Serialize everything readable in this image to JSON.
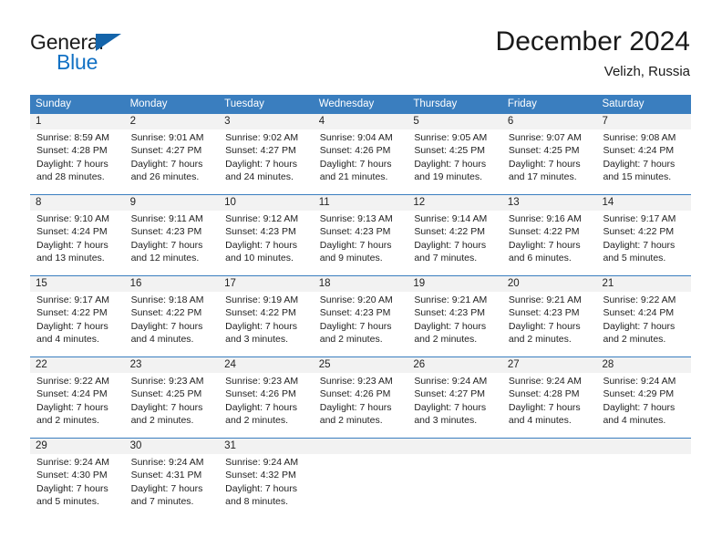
{
  "brand": {
    "name_part1": "General",
    "name_part2": "Blue",
    "logo_icon": "blue-triangle-logo"
  },
  "header": {
    "title": "December 2024",
    "subtitle": "Velizh, Russia"
  },
  "calendar": {
    "day_headers": [
      "Sunday",
      "Monday",
      "Tuesday",
      "Wednesday",
      "Thursday",
      "Friday",
      "Saturday"
    ],
    "colors": {
      "header_blue": "#3a7ebf",
      "daynum_band": "#f2f2f2",
      "brand_blue": "#1271c4",
      "text": "#222222"
    },
    "weeks": [
      {
        "days": [
          {
            "num": "1",
            "lines": [
              "Sunrise: 8:59 AM",
              "Sunset: 4:28 PM",
              "Daylight: 7 hours",
              "and 28 minutes."
            ]
          },
          {
            "num": "2",
            "lines": [
              "Sunrise: 9:01 AM",
              "Sunset: 4:27 PM",
              "Daylight: 7 hours",
              "and 26 minutes."
            ]
          },
          {
            "num": "3",
            "lines": [
              "Sunrise: 9:02 AM",
              "Sunset: 4:27 PM",
              "Daylight: 7 hours",
              "and 24 minutes."
            ]
          },
          {
            "num": "4",
            "lines": [
              "Sunrise: 9:04 AM",
              "Sunset: 4:26 PM",
              "Daylight: 7 hours",
              "and 21 minutes."
            ]
          },
          {
            "num": "5",
            "lines": [
              "Sunrise: 9:05 AM",
              "Sunset: 4:25 PM",
              "Daylight: 7 hours",
              "and 19 minutes."
            ]
          },
          {
            "num": "6",
            "lines": [
              "Sunrise: 9:07 AM",
              "Sunset: 4:25 PM",
              "Daylight: 7 hours",
              "and 17 minutes."
            ]
          },
          {
            "num": "7",
            "lines": [
              "Sunrise: 9:08 AM",
              "Sunset: 4:24 PM",
              "Daylight: 7 hours",
              "and 15 minutes."
            ]
          }
        ]
      },
      {
        "days": [
          {
            "num": "8",
            "lines": [
              "Sunrise: 9:10 AM",
              "Sunset: 4:24 PM",
              "Daylight: 7 hours",
              "and 13 minutes."
            ]
          },
          {
            "num": "9",
            "lines": [
              "Sunrise: 9:11 AM",
              "Sunset: 4:23 PM",
              "Daylight: 7 hours",
              "and 12 minutes."
            ]
          },
          {
            "num": "10",
            "lines": [
              "Sunrise: 9:12 AM",
              "Sunset: 4:23 PM",
              "Daylight: 7 hours",
              "and 10 minutes."
            ]
          },
          {
            "num": "11",
            "lines": [
              "Sunrise: 9:13 AM",
              "Sunset: 4:23 PM",
              "Daylight: 7 hours",
              "and 9 minutes."
            ]
          },
          {
            "num": "12",
            "lines": [
              "Sunrise: 9:14 AM",
              "Sunset: 4:22 PM",
              "Daylight: 7 hours",
              "and 7 minutes."
            ]
          },
          {
            "num": "13",
            "lines": [
              "Sunrise: 9:16 AM",
              "Sunset: 4:22 PM",
              "Daylight: 7 hours",
              "and 6 minutes."
            ]
          },
          {
            "num": "14",
            "lines": [
              "Sunrise: 9:17 AM",
              "Sunset: 4:22 PM",
              "Daylight: 7 hours",
              "and 5 minutes."
            ]
          }
        ]
      },
      {
        "days": [
          {
            "num": "15",
            "lines": [
              "Sunrise: 9:17 AM",
              "Sunset: 4:22 PM",
              "Daylight: 7 hours",
              "and 4 minutes."
            ]
          },
          {
            "num": "16",
            "lines": [
              "Sunrise: 9:18 AM",
              "Sunset: 4:22 PM",
              "Daylight: 7 hours",
              "and 4 minutes."
            ]
          },
          {
            "num": "17",
            "lines": [
              "Sunrise: 9:19 AM",
              "Sunset: 4:22 PM",
              "Daylight: 7 hours",
              "and 3 minutes."
            ]
          },
          {
            "num": "18",
            "lines": [
              "Sunrise: 9:20 AM",
              "Sunset: 4:23 PM",
              "Daylight: 7 hours",
              "and 2 minutes."
            ]
          },
          {
            "num": "19",
            "lines": [
              "Sunrise: 9:21 AM",
              "Sunset: 4:23 PM",
              "Daylight: 7 hours",
              "and 2 minutes."
            ]
          },
          {
            "num": "20",
            "lines": [
              "Sunrise: 9:21 AM",
              "Sunset: 4:23 PM",
              "Daylight: 7 hours",
              "and 2 minutes."
            ]
          },
          {
            "num": "21",
            "lines": [
              "Sunrise: 9:22 AM",
              "Sunset: 4:24 PM",
              "Daylight: 7 hours",
              "and 2 minutes."
            ]
          }
        ]
      },
      {
        "days": [
          {
            "num": "22",
            "lines": [
              "Sunrise: 9:22 AM",
              "Sunset: 4:24 PM",
              "Daylight: 7 hours",
              "and 2 minutes."
            ]
          },
          {
            "num": "23",
            "lines": [
              "Sunrise: 9:23 AM",
              "Sunset: 4:25 PM",
              "Daylight: 7 hours",
              "and 2 minutes."
            ]
          },
          {
            "num": "24",
            "lines": [
              "Sunrise: 9:23 AM",
              "Sunset: 4:26 PM",
              "Daylight: 7 hours",
              "and 2 minutes."
            ]
          },
          {
            "num": "25",
            "lines": [
              "Sunrise: 9:23 AM",
              "Sunset: 4:26 PM",
              "Daylight: 7 hours",
              "and 2 minutes."
            ]
          },
          {
            "num": "26",
            "lines": [
              "Sunrise: 9:24 AM",
              "Sunset: 4:27 PM",
              "Daylight: 7 hours",
              "and 3 minutes."
            ]
          },
          {
            "num": "27",
            "lines": [
              "Sunrise: 9:24 AM",
              "Sunset: 4:28 PM",
              "Daylight: 7 hours",
              "and 4 minutes."
            ]
          },
          {
            "num": "28",
            "lines": [
              "Sunrise: 9:24 AM",
              "Sunset: 4:29 PM",
              "Daylight: 7 hours",
              "and 4 minutes."
            ]
          }
        ]
      },
      {
        "days": [
          {
            "num": "29",
            "lines": [
              "Sunrise: 9:24 AM",
              "Sunset: 4:30 PM",
              "Daylight: 7 hours",
              "and 5 minutes."
            ]
          },
          {
            "num": "30",
            "lines": [
              "Sunrise: 9:24 AM",
              "Sunset: 4:31 PM",
              "Daylight: 7 hours",
              "and 7 minutes."
            ]
          },
          {
            "num": "31",
            "lines": [
              "Sunrise: 9:24 AM",
              "Sunset: 4:32 PM",
              "Daylight: 7 hours",
              "and 8 minutes."
            ]
          },
          {
            "num": "",
            "lines": []
          },
          {
            "num": "",
            "lines": []
          },
          {
            "num": "",
            "lines": []
          },
          {
            "num": "",
            "lines": []
          }
        ]
      }
    ]
  }
}
